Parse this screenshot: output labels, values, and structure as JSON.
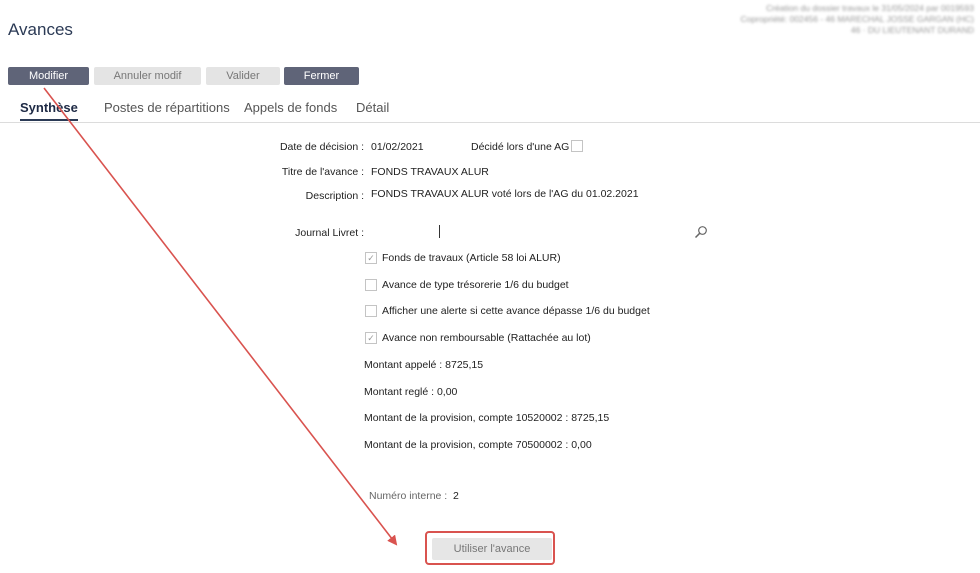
{
  "header": {
    "title": "Avances",
    "info_lines": [
      "Création du dossier travaux le 31/05/2024 par 0019593",
      "Copropriété: 002456 - 46 MARECHAL JOSSE GARGAN (HC)",
      "46 · DU LIEUTENANT DURAND"
    ]
  },
  "toolbar": {
    "modifier": "Modifier",
    "annuler": "Annuler modif",
    "valider": "Valider",
    "fermer": "Fermer"
  },
  "tabs": [
    "Synthèse",
    "Postes de répartitions",
    "Appels de fonds",
    "Détail"
  ],
  "form": {
    "date_decision_label": "Date de décision :",
    "date_decision_value": "01/02/2021",
    "decide_ag_label": "Décidé lors d'une AG",
    "titre_label": "Titre de l'avance :",
    "titre_value": "FONDS TRAVAUX ALUR",
    "description_label": "Description :",
    "description_value": "FONDS TRAVAUX ALUR voté lors de l'AG du 01.02.2021",
    "journal_label": "Journal Livret :"
  },
  "checkboxes": [
    {
      "label": "Fonds de travaux (Article 58 loi ALUR)",
      "checked": true
    },
    {
      "label": "Avance de type trésorerie 1/6 du budget",
      "checked": false
    },
    {
      "label": "Afficher une alerte si cette avance dépasse 1/6 du budget",
      "checked": false
    },
    {
      "label": "Avance non remboursable (Rattachée au lot)",
      "checked": true
    }
  ],
  "amounts": {
    "appele": "Montant appelé : 8725,15",
    "regle": "Montant reglé : 0,00",
    "provision_1": "Montant de la provision, compte 10520002 : 8725,15",
    "provision_2": "Montant de la provision, compte 70500002 : 0,00"
  },
  "numero": {
    "label": "Numéro interne :",
    "value": "2"
  },
  "actions": {
    "utiliser": "Utiliser l'avance"
  },
  "colors": {
    "annotation": "#d9534f",
    "primary_button": "#5f6478"
  },
  "icons": {
    "journal_search": "search-icon"
  }
}
